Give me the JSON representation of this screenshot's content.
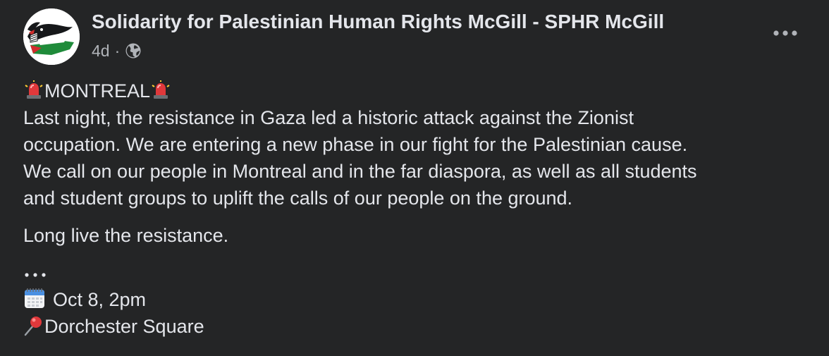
{
  "post": {
    "author": "Solidarity for Palestinian Human Rights McGill - SPHR McGill",
    "time": "4d",
    "separator": "·",
    "privacy_icon": "globe-icon",
    "more_icon": "more-options-icon",
    "body": {
      "heading_emoji": "rotating-light-emoji",
      "heading": "MONTREAL",
      "line1": "Last night, the resistance in Gaza led a historic attack against the Zionist",
      "line2": "occupation. We are entering a new phase in our fight for the Palestinian cause.",
      "line3": "We call on our people in Montreal and in the far diaspora, as well as all students",
      "line4": "and student groups to uplift the calls of our people on the ground.",
      "slogan": "Long live the resistance.",
      "ellipsis": "…",
      "date_emoji": "calendar-emoji",
      "date": "Oct 8, 2pm",
      "location_emoji": "round-pushpin-emoji",
      "location": "Dorchester Square"
    }
  },
  "colors": {
    "background": "#242526",
    "primary_text": "#e4e6eb",
    "secondary_text": "#b0b3b8",
    "siren_red": "#e0383b"
  }
}
